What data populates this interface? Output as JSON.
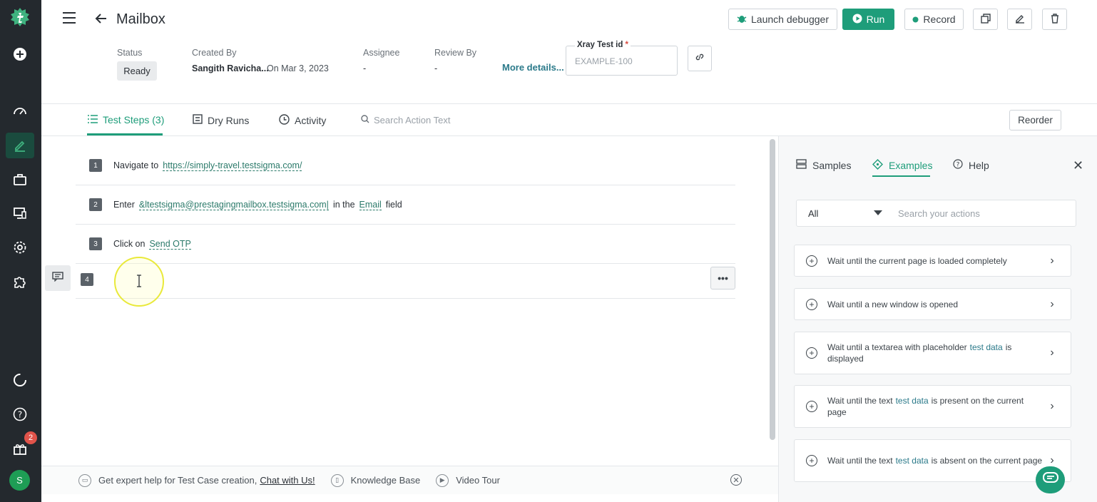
{
  "header": {
    "title": "Mailbox",
    "launch_debugger": "Launch debugger",
    "run": "Run",
    "record": "Record"
  },
  "meta": {
    "status_label": "Status",
    "status_value": "Ready",
    "created_by_label": "Created By",
    "created_by_name": "Sangith Ravicha...",
    "created_on": "On Mar 3, 2023",
    "assignee_label": "Assignee",
    "assignee_value": "-",
    "review_label": "Review By",
    "review_value": "-",
    "more_details": "More details...",
    "xray_label": "Xray Test id",
    "xray_required": "*",
    "xray_placeholder": "EXAMPLE-100"
  },
  "tabs": {
    "steps": "Test Steps (3)",
    "dry_runs": "Dry Runs",
    "activity": "Activity",
    "search_placeholder": "Search Action Text",
    "reorder": "Reorder"
  },
  "steps": [
    {
      "num": "1",
      "pre": "Navigate to",
      "token": "https://simply-travel.testsigma.com/",
      "post": ""
    },
    {
      "num": "2",
      "pre": "Enter",
      "token": "&ltestsigma@prestagingmailbox.testsigma.com|",
      "mid": "in the",
      "token2": "Email",
      "post": "field"
    },
    {
      "num": "3",
      "pre": "Click on",
      "token": "Send OTP",
      "post": ""
    },
    {
      "num": "4"
    }
  ],
  "panel": {
    "samples": "Samples",
    "examples": "Examples",
    "help": "Help",
    "filter_value": "All",
    "search_placeholder": "Search your actions",
    "cards": [
      {
        "a": "Wait until the current page is loaded completely"
      },
      {
        "a": "Wait until a new window is opened"
      },
      {
        "a": "Wait until a textarea with placeholder",
        "td": "test data",
        "b": "is displayed"
      },
      {
        "a": "Wait until the text",
        "td": "test data",
        "b": "is present on the current page"
      },
      {
        "a": "Wait until the text",
        "td": "test data",
        "b": "is absent on the current page"
      }
    ]
  },
  "footer": {
    "help_text": "Get expert help for Test Case creation,",
    "chat_link": "Chat with Us!",
    "kb": "Knowledge Base",
    "tour": "Video Tour"
  },
  "sidebar": {
    "notification_count": "2",
    "avatar_initial": "S"
  },
  "colors": {
    "brand": "#1e9d7a",
    "rail": "#24292e",
    "badge": "#e0534a"
  }
}
